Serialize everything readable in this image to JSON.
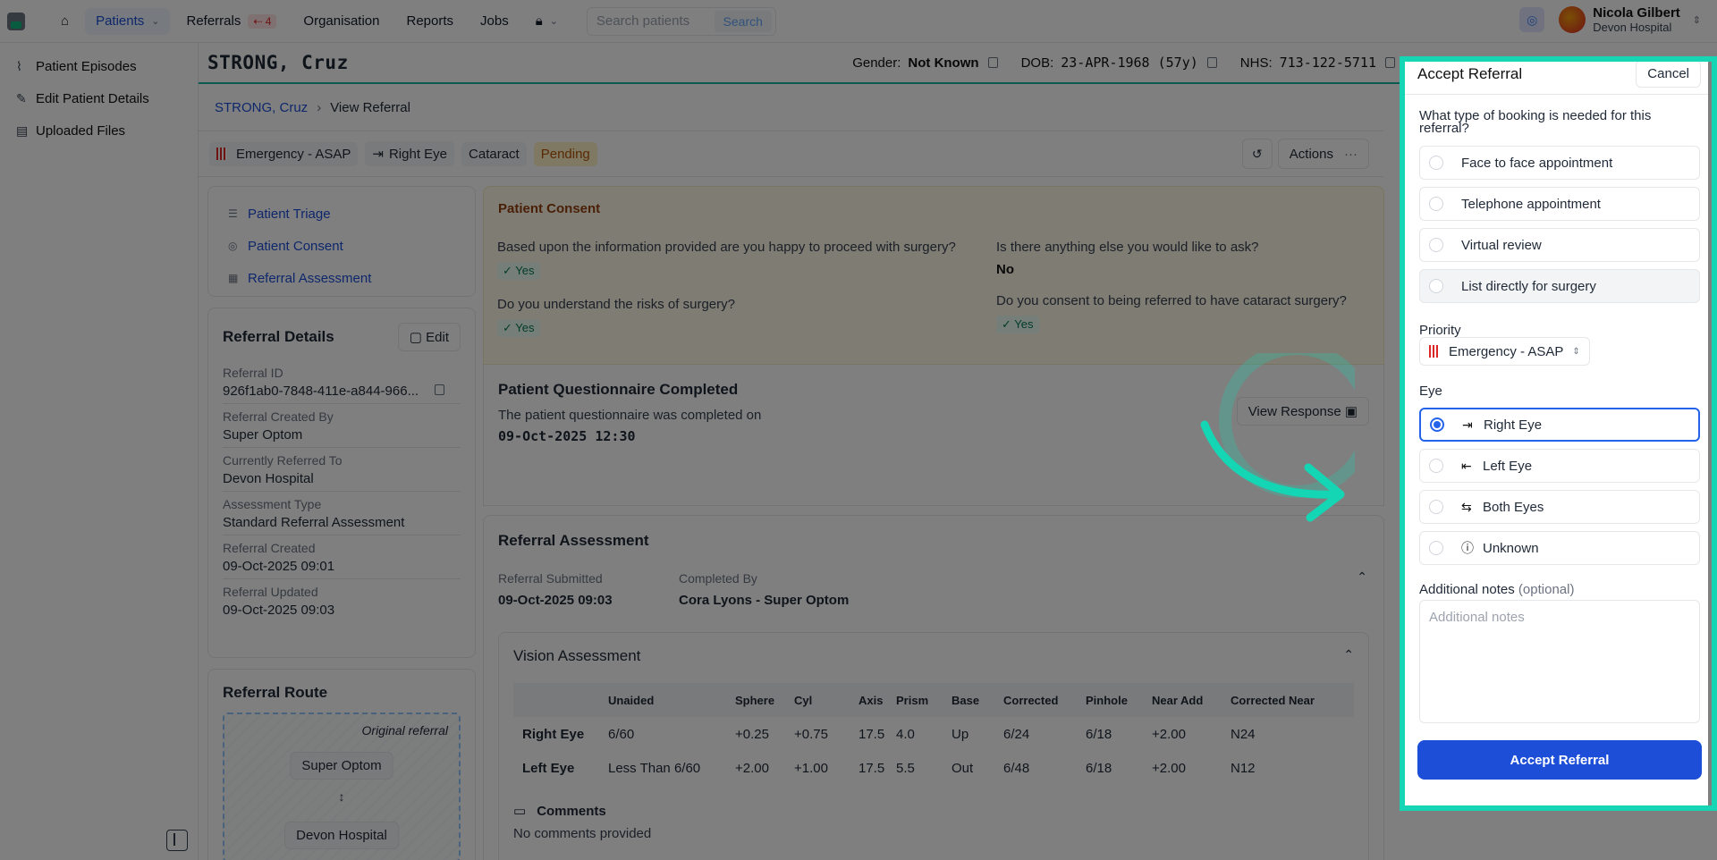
{
  "nav": {
    "items": [
      {
        "label": "Patients",
        "active": true
      },
      {
        "label": "Referrals",
        "badge": "4"
      },
      {
        "label": "Organisation"
      },
      {
        "label": "Reports"
      },
      {
        "label": "Jobs"
      }
    ],
    "search_placeholder": "Search patients",
    "search_button": "Search",
    "user_name": "Nicola Gilbert",
    "user_org": "Devon Hospital"
  },
  "sidebar": {
    "items": [
      {
        "label": "Patient Episodes",
        "icon": "activity-icon"
      },
      {
        "label": "Edit Patient Details",
        "icon": "pencil-icon"
      },
      {
        "label": "Uploaded Files",
        "icon": "file-icon"
      }
    ]
  },
  "patient": {
    "name": "STRONG, Cruz",
    "gender_label": "Gender:",
    "gender": "Not Known",
    "dob_label": "DOB:",
    "dob": "23-APR-1968 (57y)",
    "nhs_label": "NHS:",
    "nhs": "713-122-5711"
  },
  "breadcrumb": {
    "patient": "STRONG, Cruz",
    "current": "View Referral"
  },
  "tags": {
    "priority": "Emergency - ASAP",
    "eye": "Right Eye",
    "condition": "Cataract",
    "status": "Pending",
    "actions": "Actions"
  },
  "section_nav": [
    "Patient Triage",
    "Patient Consent",
    "Referral Assessment"
  ],
  "details": {
    "title": "Referral Details",
    "edit": "Edit",
    "rows": [
      {
        "k": "Referral ID",
        "v": "926f1ab0-7848-411e-a844-966..."
      },
      {
        "k": "Referral Created By",
        "v": "Super Optom"
      },
      {
        "k": "Currently Referred To",
        "v": "Devon Hospital"
      },
      {
        "k": "Assessment Type",
        "v": "Standard Referral Assessment"
      },
      {
        "k": "Referral Created",
        "v": "09-Oct-2025 09:01"
      },
      {
        "k": "Referral Updated",
        "v": "09-Oct-2025 09:03"
      }
    ]
  },
  "route": {
    "title": "Referral Route",
    "original": "Original referral",
    "from": "Super Optom",
    "to": "Devon Hospital"
  },
  "consent": {
    "title": "Patient Consent",
    "q1": "Based upon the information provided are you happy to proceed with surgery?",
    "a1": "Yes",
    "q2": "Do you understand the risks of surgery?",
    "a2": "Yes",
    "q3": "Is there anything else you would like to ask?",
    "a3": "No",
    "q4": "Do you consent to being referred to have cataract surgery?",
    "a4": "Yes"
  },
  "questionnaire": {
    "title": "Patient Questionnaire Completed",
    "text": "The patient questionnaire was completed on",
    "date": "09-Oct-2025 12:30",
    "view": "View Response"
  },
  "assessment": {
    "title": "Referral Assessment",
    "submitted_label": "Referral Submitted",
    "submitted": "09-Oct-2025 09:03",
    "completed_label": "Completed By",
    "completed": "Cora Lyons - Super Optom",
    "vision_title": "Vision Assessment",
    "columns": [
      "",
      "Unaided",
      "Sphere",
      "Cyl",
      "Axis",
      "Prism",
      "Base",
      "Corrected",
      "Pinhole",
      "Near Add",
      "Corrected Near"
    ],
    "rows": [
      [
        "Right Eye",
        "6/60",
        "+0.25",
        "+0.75",
        "17.5",
        "4.0",
        "Up",
        "6/24",
        "6/18",
        "+2.00",
        "N24"
      ],
      [
        "Left Eye",
        "Less Than 6/60",
        "+2.00",
        "+1.00",
        "17.5",
        "5.5",
        "Out",
        "6/48",
        "6/18",
        "+2.00",
        "N12"
      ]
    ],
    "comments_title": "Comments",
    "comments": "No comments provided"
  },
  "panel": {
    "title": "Accept Referral",
    "cancel": "Cancel",
    "question": "What type of booking is needed for this referral?",
    "booking_options": [
      "Face to face appointment",
      "Telephone appointment",
      "Virtual review",
      "List directly for surgery"
    ],
    "priority_label": "Priority",
    "priority_value": "Emergency - ASAP",
    "eye_label": "Eye",
    "eye_options": [
      "Right Eye",
      "Left Eye",
      "Both Eyes",
      "Unknown"
    ],
    "notes_label": "Additional notes",
    "notes_optional": "(optional)",
    "notes_placeholder": "Additional notes",
    "accept": "Accept Referral"
  },
  "colors": {
    "accent": "#1d4ed8",
    "highlight": "#14d6b4",
    "pending": "#b45309"
  }
}
